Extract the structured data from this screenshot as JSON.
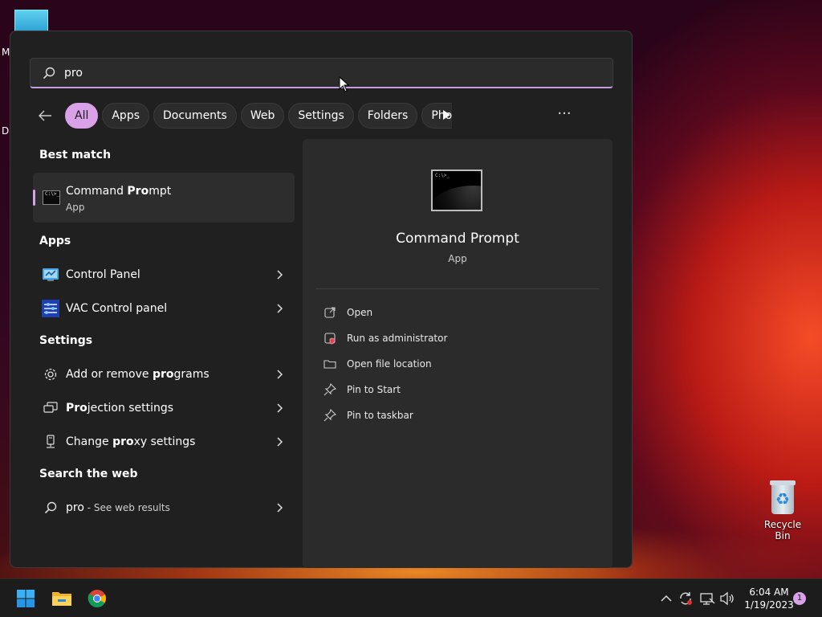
{
  "desktop": {
    "edge_labels": [
      "M",
      "D"
    ],
    "recycle_bin_label": "Recycle Bin"
  },
  "search": {
    "query": "pro",
    "icon": "search-icon"
  },
  "filters": {
    "items": [
      "All",
      "Apps",
      "Documents",
      "Web",
      "Settings",
      "Folders",
      "Pho"
    ],
    "active": "All",
    "more_label": "···"
  },
  "results": {
    "best_match_header": "Best match",
    "best_match": {
      "name_prefix": "Command ",
      "name_match": "Pro",
      "name_suffix": "mpt",
      "type": "App"
    },
    "apps_header": "Apps",
    "apps": [
      {
        "label": "Control Panel",
        "icon": "control-panel-icon"
      },
      {
        "label": "VAC Control panel",
        "icon": "vac-control-panel-icon"
      }
    ],
    "settings_header": "Settings",
    "settings": [
      {
        "prefix": "Add or remove ",
        "match": "pro",
        "suffix": "grams",
        "icon": "gear-icon"
      },
      {
        "prefix": "",
        "match": "Pro",
        "suffix": "jection settings",
        "icon": "projection-icon"
      },
      {
        "prefix": "Change ",
        "match": "pro",
        "suffix": "xy settings",
        "icon": "proxy-icon"
      }
    ],
    "web_header": "Search the web",
    "web": {
      "query": "pro",
      "suffix": " - See web results"
    }
  },
  "detail": {
    "title": "Command Prompt",
    "subtitle": "App",
    "icon_prompt": "C:\\>_",
    "actions": [
      {
        "label": "Open",
        "icon": "open-external-icon"
      },
      {
        "label": "Run as administrator",
        "icon": "admin-shield-icon"
      },
      {
        "label": "Open file location",
        "icon": "folder-icon"
      },
      {
        "label": "Pin to Start",
        "icon": "pin-icon"
      },
      {
        "label": "Pin to taskbar",
        "icon": "pin-icon"
      }
    ]
  },
  "taskbar": {
    "time": "6:04 AM",
    "date": "1/19/2023",
    "notification_count": "1"
  },
  "colors": {
    "accent": "#d9a2e8",
    "panel_bg": "#202020",
    "pane_bg": "#2b2b2b"
  }
}
